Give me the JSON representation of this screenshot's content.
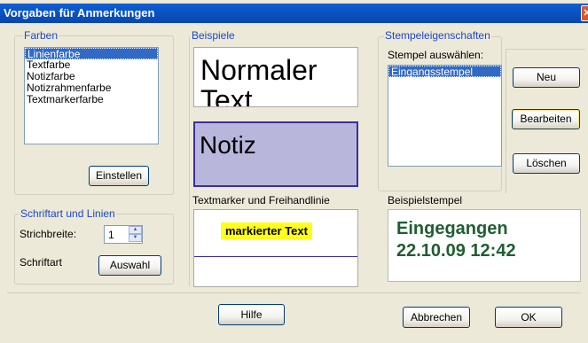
{
  "window": {
    "title": "Vorgaben für Anmerkungen",
    "close_glyph": "✕"
  },
  "colors_group": {
    "label": "Farben",
    "items": [
      "Linienfarbe",
      "Textfarbe",
      "Notizfarbe",
      "Notizrahmenfarbe",
      "Textmarkerfarbe"
    ],
    "selected_index": 0,
    "set_button": "Einstellen"
  },
  "font_group": {
    "label": "Schriftart und Linien",
    "stroke_label": "Strichbreite:",
    "stroke_value": "1",
    "font_label": "Schriftart",
    "select_button": "Auswahl"
  },
  "examples": {
    "label": "Beispiele",
    "normal_text": "Normaler Text",
    "note_text": "Notiz",
    "highlighter_label": "Textmarker und Freihandlinie",
    "highlighted_text": "markierter Text"
  },
  "stamp_group": {
    "label": "Stempeleigenschaften",
    "choose_label": "Stempel auswählen:",
    "stamps": [
      "Eingangsstempel"
    ],
    "new_button": "Neu",
    "edit_button": "Bearbeiten",
    "delete_button": "Löschen",
    "sample_label": "Beispielstempel",
    "sample_line1": "Eingegangen",
    "sample_line2": "22.10.09 12:42"
  },
  "footer": {
    "help_button": "Hilfe",
    "cancel_button": "Abbrechen",
    "ok_button": "OK"
  },
  "colors": {
    "titlebar": "#0a5fd6",
    "group_label": "#1c48c4",
    "selection": "#316ac5",
    "note_fill": "#b9b6db",
    "note_border": "#3a2f9f",
    "highlight": "#ffff1a",
    "stamp_text": "#1f5e31"
  },
  "icons": {
    "close": "close-icon",
    "spin_up": "chevron-up-icon",
    "spin_down": "chevron-down-icon"
  }
}
